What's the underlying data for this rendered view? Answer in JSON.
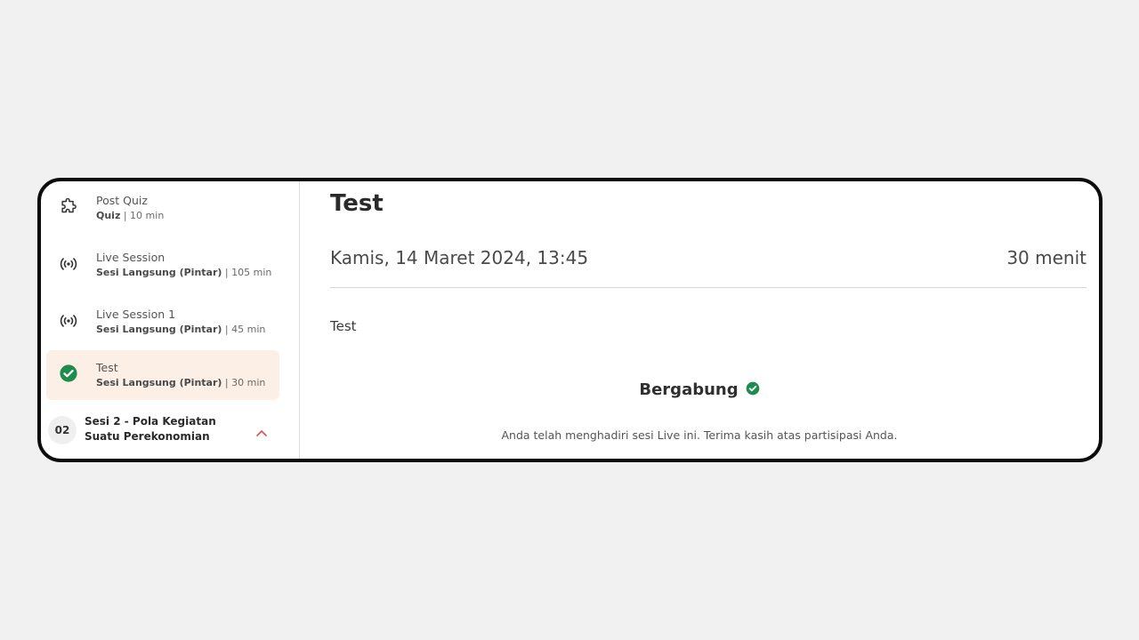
{
  "sidebar": {
    "items": [
      {
        "icon": "puzzle-icon",
        "title": "Post Quiz",
        "type": "Quiz",
        "duration": "| 10 min",
        "active": false
      },
      {
        "icon": "broadcast-icon",
        "title": "Live Session",
        "type": "Sesi Langsung (Pintar)",
        "duration": "| 105 min",
        "active": false
      },
      {
        "icon": "broadcast-icon",
        "title": "Live Session 1",
        "type": "Sesi Langsung (Pintar)",
        "duration": "| 45 min",
        "active": false
      },
      {
        "icon": "check-circle-icon",
        "title": "Test",
        "type": "Sesi Langsung (Pintar)",
        "duration": "| 30 min",
        "active": true
      }
    ],
    "section": {
      "number": "02",
      "label": "Sesi 2 - Pola Kegiatan Suatu Perekonomian",
      "icon": "chevron-up-icon"
    }
  },
  "main": {
    "title": "Test",
    "date": "Kamis, 14 Maret 2024, 13:45",
    "duration": "30 menit",
    "description": "Test",
    "status_label": "Bergabung",
    "status_note": "Anda telah menghadiri sesi Live ini. Terima kasih atas partisipasi Anda."
  },
  "colors": {
    "accent_green": "#1e8c4e",
    "active_bg": "#fcefe6",
    "chevron": "#d9534f"
  }
}
